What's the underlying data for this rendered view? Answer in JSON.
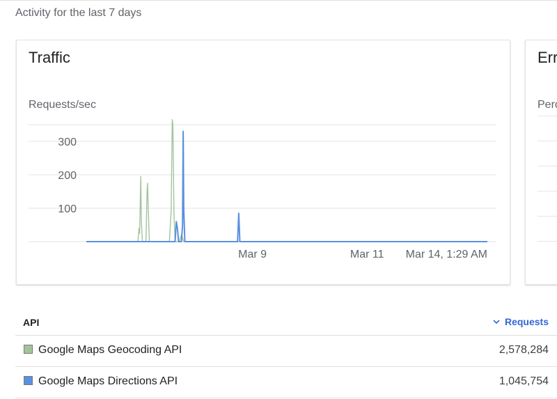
{
  "header": {
    "activity_label": "Activity for the last 7 days"
  },
  "traffic": {
    "title": "Traffic",
    "chart_data": {
      "type": "line",
      "title": "Traffic",
      "ylabel": "Requests/sec",
      "xlabel": "",
      "ylim": [
        0,
        400
      ],
      "y_ticks": [
        100,
        200,
        300
      ],
      "x_tick_labels": [
        {
          "label": "Mar 9",
          "t": 2.9
        },
        {
          "label": "Mar 11",
          "t": 4.9
        },
        {
          "label": "Mar 14, 1:29 AM",
          "t": 7.0
        }
      ],
      "grid": true,
      "series": [
        {
          "name": "Google Maps Geocoding API",
          "color": "#a4c39a",
          "points": [
            [
              0,
              0
            ],
            [
              0.9,
              0
            ],
            [
              0.92,
              40
            ],
            [
              0.93,
              25
            ],
            [
              0.95,
              195
            ],
            [
              0.96,
              60
            ],
            [
              0.98,
              0
            ],
            [
              1.04,
              0
            ],
            [
              1.06,
              150
            ],
            [
              1.07,
              175
            ],
            [
              1.08,
              100
            ],
            [
              1.1,
              0
            ],
            [
              1.45,
              0
            ],
            [
              1.48,
              90
            ],
            [
              1.5,
              365
            ],
            [
              1.51,
              350
            ],
            [
              1.53,
              80
            ],
            [
              1.55,
              0
            ],
            [
              1.62,
              0
            ],
            [
              1.66,
              20
            ],
            [
              1.7,
              0
            ],
            [
              7.0,
              0
            ]
          ]
        },
        {
          "name": "Google Maps Directions API",
          "color": "#5b8fe0",
          "points": [
            [
              0,
              0
            ],
            [
              1.55,
              0
            ],
            [
              1.57,
              60
            ],
            [
              1.59,
              40
            ],
            [
              1.61,
              0
            ],
            [
              1.66,
              0
            ],
            [
              1.68,
              50
            ],
            [
              1.69,
              330
            ],
            [
              1.7,
              100
            ],
            [
              1.72,
              0
            ],
            [
              2.64,
              0
            ],
            [
              2.66,
              85
            ],
            [
              2.68,
              0
            ],
            [
              7.0,
              0
            ]
          ]
        }
      ]
    }
  },
  "errors": {
    "title": "Errors",
    "subtitle": "Percent of requests"
  },
  "table": {
    "col_api": "API",
    "col_requests": "Requests",
    "rows": [
      {
        "name": "Google Maps Geocoding API",
        "requests": "2,578,284",
        "color": "#a4c39a"
      },
      {
        "name": "Google Maps Directions API",
        "requests": "1,045,754",
        "color": "#5b8fe0"
      }
    ]
  }
}
